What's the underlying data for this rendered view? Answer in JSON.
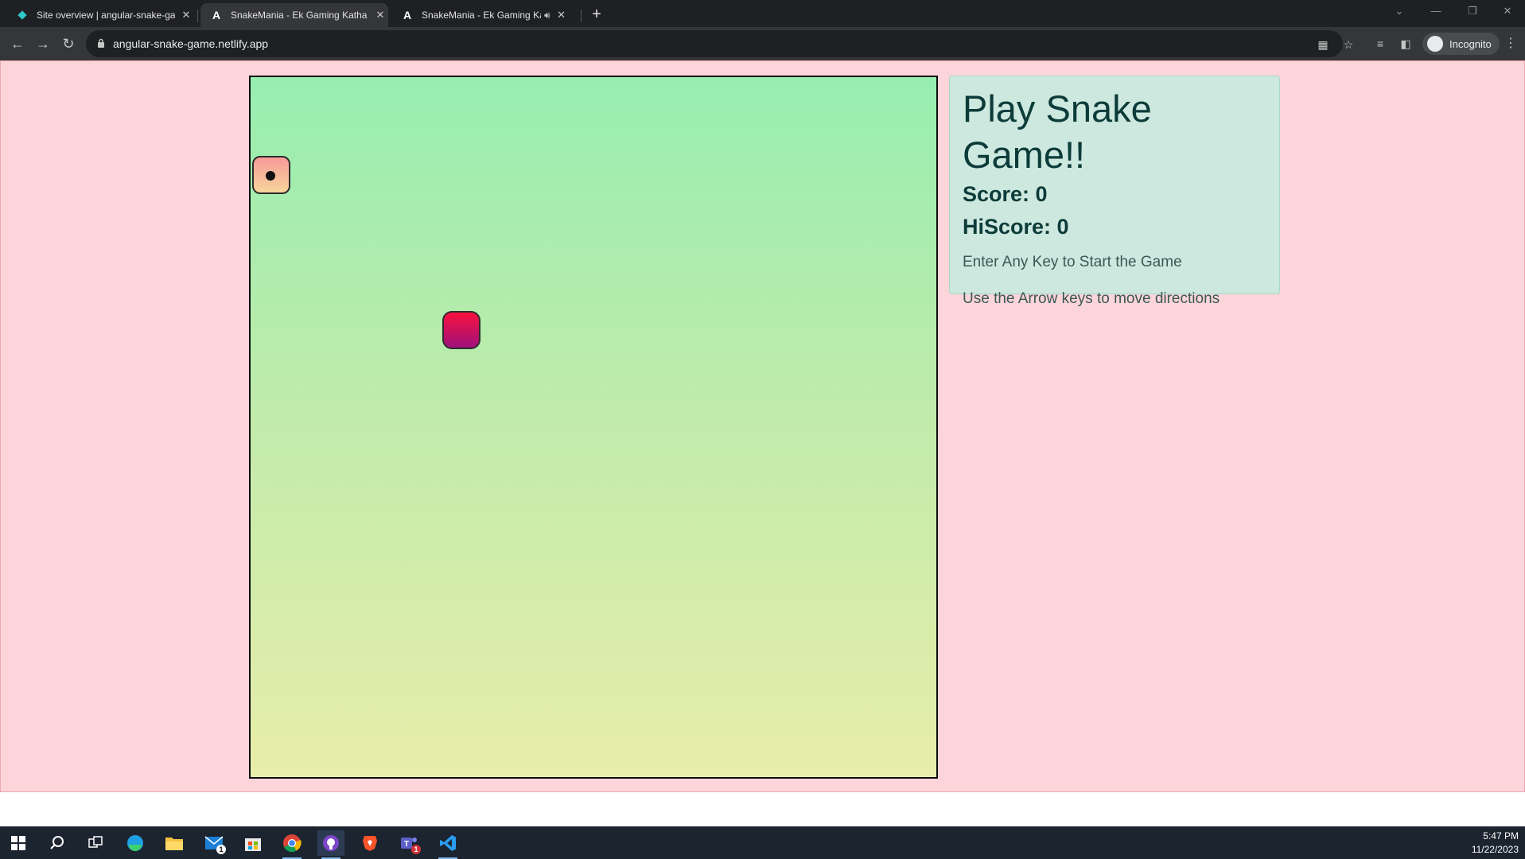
{
  "browser": {
    "tabs": [
      {
        "title": "Site overview | angular-snake-ga",
        "favicon": "netlify-diamond-icon",
        "active": false
      },
      {
        "title": "SnakeMania - Ek Gaming Katha",
        "favicon": "angular-a-icon",
        "active": true
      },
      {
        "title": "SnakeMania - Ek Gaming Ka",
        "favicon": "angular-a-icon",
        "active": false,
        "audio": true
      }
    ],
    "new_tab_label": "+",
    "url": "angular-snake-game.netlify.app",
    "profile_label": "Incognito"
  },
  "game": {
    "title": "Play Snake Game!!",
    "score_label": "Score: 0",
    "hiscore_label": "HiScore: 0",
    "start_instruction": "Enter Any Key to Start the Game",
    "move_instruction": "Use the Arrow keys to move directions",
    "colors": {
      "page_bg": "#fcd5da",
      "board_top": "#97eeb0",
      "board_bottom": "#e8edaa",
      "food_top": "#f9113f",
      "food_bottom": "#a0117a",
      "panel_bg": "#cde8de"
    }
  },
  "taskbar": {
    "apps": [
      "windows-start-icon",
      "search-icon",
      "task-view-icon",
      "edge-icon",
      "file-explorer-icon",
      "mail-icon",
      "store-icon",
      "chrome-icon",
      "github-desktop-icon",
      "brave-icon",
      "teams-icon",
      "vscode-icon"
    ],
    "mail_badge": "1",
    "teams_badge": "1",
    "time": "5:47 PM",
    "date": "11/22/2023"
  }
}
